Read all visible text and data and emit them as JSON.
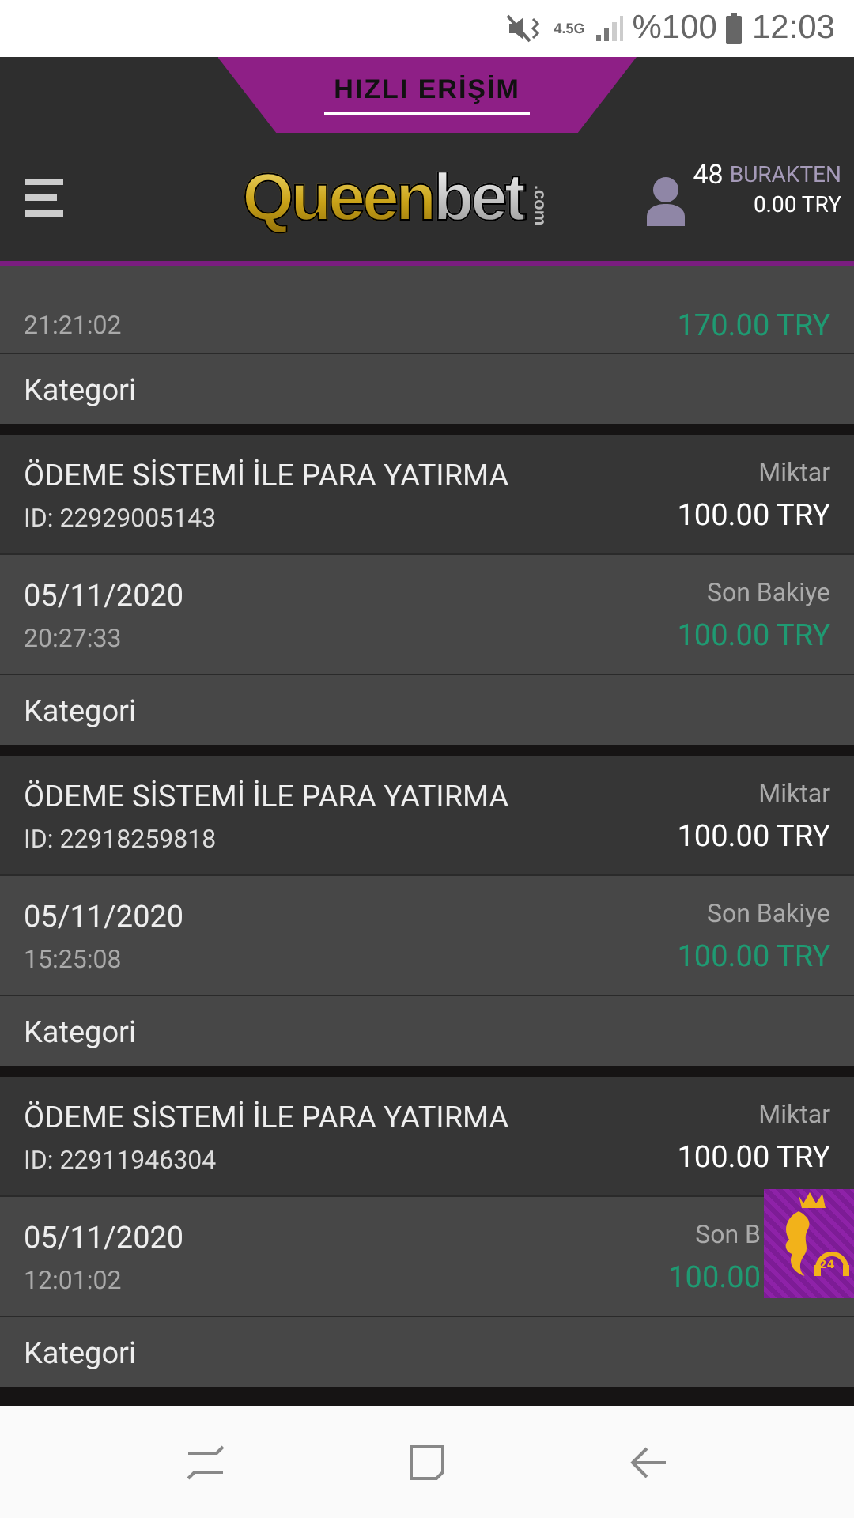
{
  "status_bar": {
    "network": "4.5G",
    "battery": "%100",
    "time": "12:03"
  },
  "quick_access": {
    "label": "HIZLI ERİŞİM"
  },
  "header": {
    "logo": {
      "main": "Queen",
      "accent": "bet",
      "suffix": ".com"
    },
    "user": {
      "count": "48",
      "name": "BURAKTEN",
      "balance": "0.00 TRY"
    }
  },
  "transactions": [
    {
      "time": "21:21:02",
      "balance": "170.00 TRY",
      "category": "Kategori"
    },
    {
      "title": "ÖDEME SİSTEMİ İLE PARA YATIRMA",
      "id": "ID: 22929005143",
      "amount_label": "Miktar",
      "amount": "100.00 TRY",
      "date": "05/11/2020",
      "time": "20:27:33",
      "balance_label": "Son Bakiye",
      "balance": "100.00 TRY",
      "category": "Kategori"
    },
    {
      "title": "ÖDEME SİSTEMİ İLE PARA YATIRMA",
      "id": "ID: 22918259818",
      "amount_label": "Miktar",
      "amount": "100.00 TRY",
      "date": "05/11/2020",
      "time": "15:25:08",
      "balance_label": "Son Bakiye",
      "balance": "100.00 TRY",
      "category": "Kategori"
    },
    {
      "title": "ÖDEME SİSTEMİ İLE PARA YATIRMA",
      "id": "ID: 22911946304",
      "amount_label": "Miktar",
      "amount": "100.00 TRY",
      "date": "05/11/2020",
      "time": "12:01:02",
      "balance_label": "Son B",
      "balance": "100.00",
      "category": "Kategori"
    }
  ],
  "support_badge": {
    "label": "24"
  }
}
